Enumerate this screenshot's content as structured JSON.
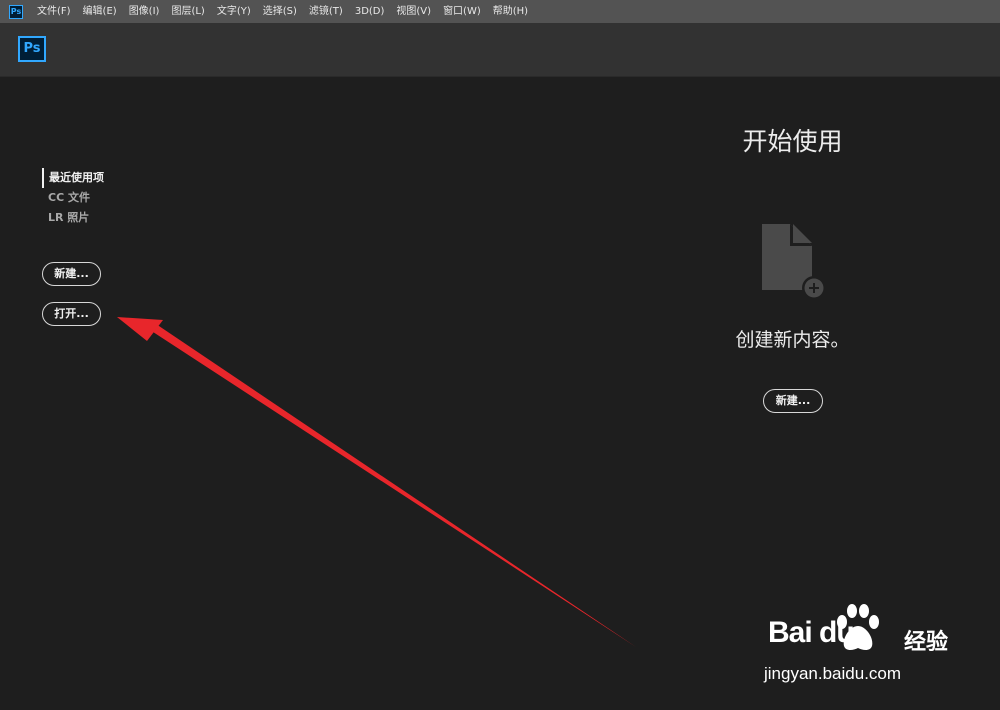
{
  "menubar": {
    "app_icon": "Ps",
    "items": [
      {
        "label": "文件(F)"
      },
      {
        "label": "编辑(E)"
      },
      {
        "label": "图像(I)"
      },
      {
        "label": "图层(L)"
      },
      {
        "label": "文字(Y)"
      },
      {
        "label": "选择(S)"
      },
      {
        "label": "滤镜(T)"
      },
      {
        "label": "3D(D)"
      },
      {
        "label": "视图(V)"
      },
      {
        "label": "窗口(W)"
      },
      {
        "label": "帮助(H)"
      }
    ]
  },
  "header": {
    "logo": "Ps"
  },
  "left_nav": {
    "items": [
      {
        "label": "最近使用项",
        "active": true
      },
      {
        "label": "CC 文件",
        "active": false
      },
      {
        "label": "LR 照片",
        "active": false
      }
    ],
    "new_button": "新建...",
    "open_button": "打开..."
  },
  "right_panel": {
    "title": "开始使用",
    "create_text": "创建新内容。",
    "new_button": "新建..."
  },
  "watermark": {
    "brand": "Bai du",
    "jingyan": "经验",
    "url": "jingyan.baidu.com"
  },
  "colors": {
    "menubar_bg": "#535353",
    "header_bg": "#323232",
    "workspace_bg": "#1e1e1e",
    "ps_blue": "#31a8ff",
    "arrow_red": "#e8262b"
  },
  "icons": {
    "app": "photoshop-icon",
    "document": "new-document-icon",
    "arrow": "red-arrow-annotation"
  }
}
